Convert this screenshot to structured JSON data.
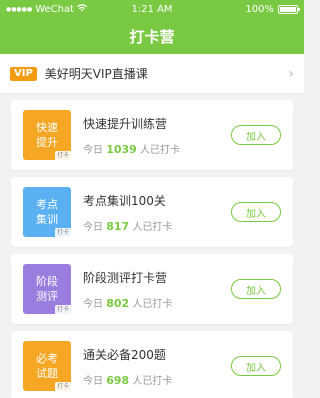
{
  "status": {
    "carrier": "WeChat",
    "time": "1:21 AM",
    "battery": "100%"
  },
  "nav": {
    "title": "打卡营"
  },
  "vip": {
    "badge": "VIP",
    "title": "美好明天VIP直播课"
  },
  "colors": {
    "accent": "#7ac943",
    "vip": "#f39c12"
  },
  "cards": [
    {
      "thumb_line1": "快速",
      "thumb_line2": "提升",
      "thumb_tag": "打卡",
      "thumb_color": "#f5a623",
      "title": "快速提升训练营",
      "meta_prefix": "今日",
      "count": "1039",
      "meta_suffix": "人已打卡",
      "button": "加入"
    },
    {
      "thumb_line1": "考点",
      "thumb_line2": "集训",
      "thumb_tag": "打卡",
      "thumb_color": "#5ab0f0",
      "title": "考点集训100关",
      "meta_prefix": "今日",
      "count": "817",
      "meta_suffix": "人已打卡",
      "button": "加入"
    },
    {
      "thumb_line1": "阶段",
      "thumb_line2": "测评",
      "thumb_tag": "打卡",
      "thumb_color": "#9b7de0",
      "title": "阶段测评打卡营",
      "meta_prefix": "今日",
      "count": "802",
      "meta_suffix": "人已打卡",
      "button": "加入"
    },
    {
      "thumb_line1": "必考",
      "thumb_line2": "试题",
      "thumb_tag": "打卡",
      "thumb_color": "#f5a623",
      "title": "通关必备200题",
      "meta_prefix": "今日",
      "count": "698",
      "meta_suffix": "人已打卡",
      "button": "加入"
    }
  ]
}
